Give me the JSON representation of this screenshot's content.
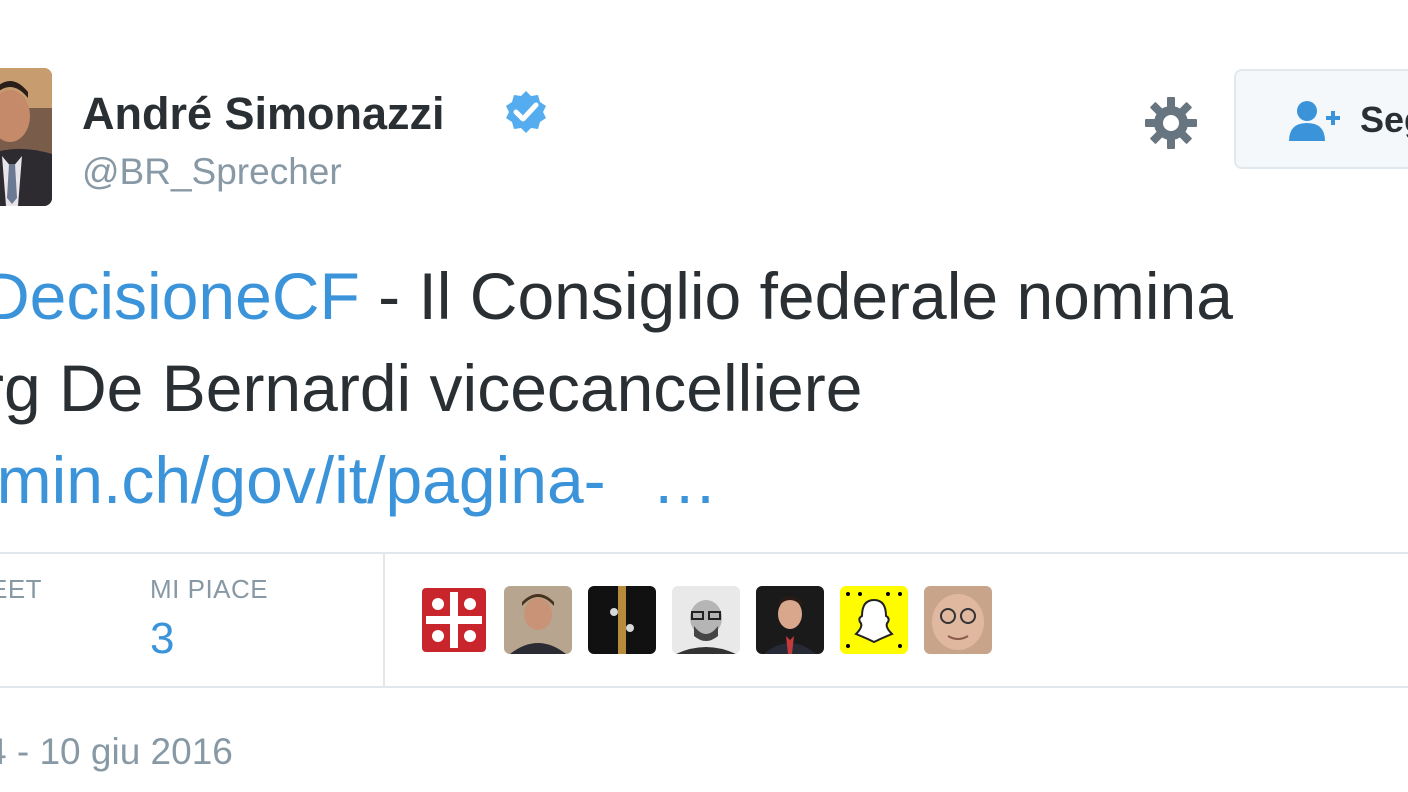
{
  "user": {
    "display_name": "André Simonazzi",
    "handle": "@BR_Sprecher",
    "verified_icon": "verified-badge-icon"
  },
  "actions": {
    "settings_icon": "gear-icon",
    "follow_label": "Seg",
    "follow_icon": "user-follow-icon"
  },
  "tweet": {
    "line1_link": "DecisioneCF",
    "line1_text": " - Il Consiglio federale nomina",
    "line2_text": "rg De Bernardi vicecancelliere",
    "line3_link": "lmin.ch/gov/it/pagina-",
    "line3_ellipsis": "…"
  },
  "stats": {
    "retweet_label": "EET",
    "likes_label": "MI PIACE",
    "likes_value": "3"
  },
  "timestamp": "4 - 10 giu 2016",
  "colors": {
    "link": "#3b94d9",
    "text": "#292f33",
    "muted": "#8899a6",
    "verified": "#55acee"
  }
}
